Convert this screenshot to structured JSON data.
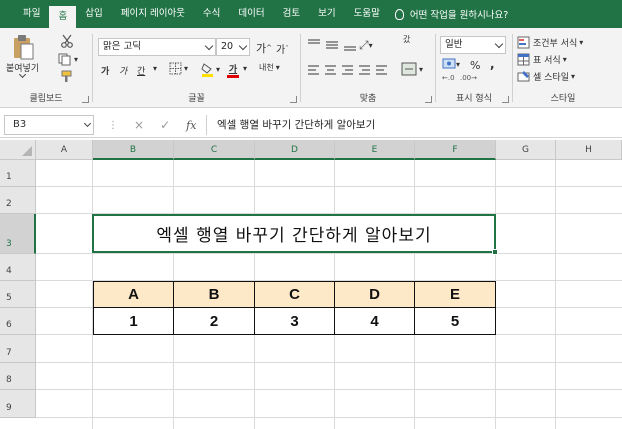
{
  "tabs": [
    "파일",
    "홈",
    "삽입",
    "페이지 레이아웃",
    "수식",
    "데이터",
    "검토",
    "보기",
    "도움말"
  ],
  "active_tab": "홈",
  "tell_me": "어떤 작업을 원하시나요?",
  "ribbon": {
    "clipboard": {
      "paste": "붙여넣기",
      "label": "클립보드"
    },
    "font": {
      "name": "맑은 고딕",
      "size": "20",
      "grow": "가",
      "shrink": "가",
      "bold": "가",
      "italic": "가",
      "underline": "간",
      "color_a": "가",
      "phonetic": "내천",
      "label": "글꼴"
    },
    "alignment": {
      "wrap": "갔",
      "label": "맞춤"
    },
    "number": {
      "format": "일반",
      "percent": "%",
      "comma": ",",
      "label": "표시 형식"
    },
    "styles": {
      "conditional": "조건부 서식",
      "table": "표 서식",
      "cell": "셀 스타일",
      "label": "스타일"
    }
  },
  "formula_bar": {
    "name_box": "B3",
    "cancel": "×",
    "enter": "✓",
    "fx": "fx",
    "content": "엑셀 행열 바꾸기 간단하게 알아보기"
  },
  "columns": [
    "A",
    "B",
    "C",
    "D",
    "E",
    "F",
    "G",
    "H"
  ],
  "rows": [
    "1",
    "2",
    "3",
    "4",
    "5",
    "6",
    "7",
    "8",
    "9"
  ],
  "sheet": {
    "title": "엑셀 행열 바꾸기 간단하게 알아보기",
    "table_header": [
      "A",
      "B",
      "C",
      "D",
      "E"
    ],
    "table_values": [
      "1",
      "2",
      "3",
      "4",
      "5"
    ],
    "header_fill": "#fde9c8",
    "accent": "#217346"
  }
}
